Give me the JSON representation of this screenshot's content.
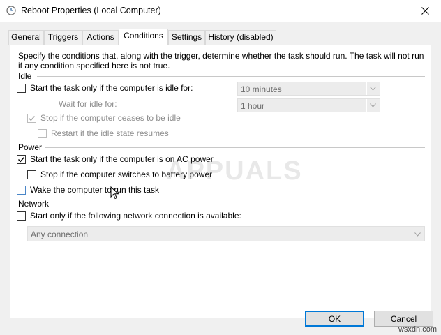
{
  "window": {
    "title": "Reboot Properties (Local Computer)",
    "icons": {
      "app": "clock-icon",
      "close": "close-icon"
    }
  },
  "tabs": [
    {
      "label": "General"
    },
    {
      "label": "Triggers"
    },
    {
      "label": "Actions"
    },
    {
      "label": "Conditions",
      "active": true
    },
    {
      "label": "Settings"
    },
    {
      "label": "History (disabled)"
    }
  ],
  "conditions": {
    "description": "Specify the conditions that, along with the trigger, determine whether the task should run.  The task will not run  if any condition specified here is not true.",
    "idle": {
      "group_label": "Idle",
      "start_if_idle": {
        "label": "Start the task only if the computer is idle for:",
        "checked": false
      },
      "idle_for": {
        "value": "10 minutes"
      },
      "wait_label": "Wait for idle for:",
      "wait_for": {
        "value": "1 hour"
      },
      "stop_if_ceases": {
        "label": "Stop if the computer ceases to be idle",
        "checked": true,
        "disabled": true
      },
      "restart_if_resumes": {
        "label": "Restart if the idle state resumes",
        "checked": false,
        "disabled": true
      }
    },
    "power": {
      "group_label": "Power",
      "start_on_ac": {
        "label": "Start the task only if the computer is on AC power",
        "checked": true
      },
      "stop_on_battery": {
        "label": "Stop if the computer switches to battery power",
        "checked": false
      },
      "wake_to_run": {
        "label": "Wake the computer to run this task",
        "checked": false
      }
    },
    "network": {
      "group_label": "Network",
      "start_if_network": {
        "label": "Start only if the following network connection is available:",
        "checked": false
      },
      "connection": {
        "value": "Any connection"
      }
    }
  },
  "watermark": "APPUALS",
  "buttons": {
    "ok": "OK",
    "cancel": "Cancel"
  },
  "credit": "wsxdn.com",
  "colors": {
    "accent": "#0078d7",
    "dialog_bg": "#f0f0f0",
    "disabled_text": "#8d8d8d"
  }
}
